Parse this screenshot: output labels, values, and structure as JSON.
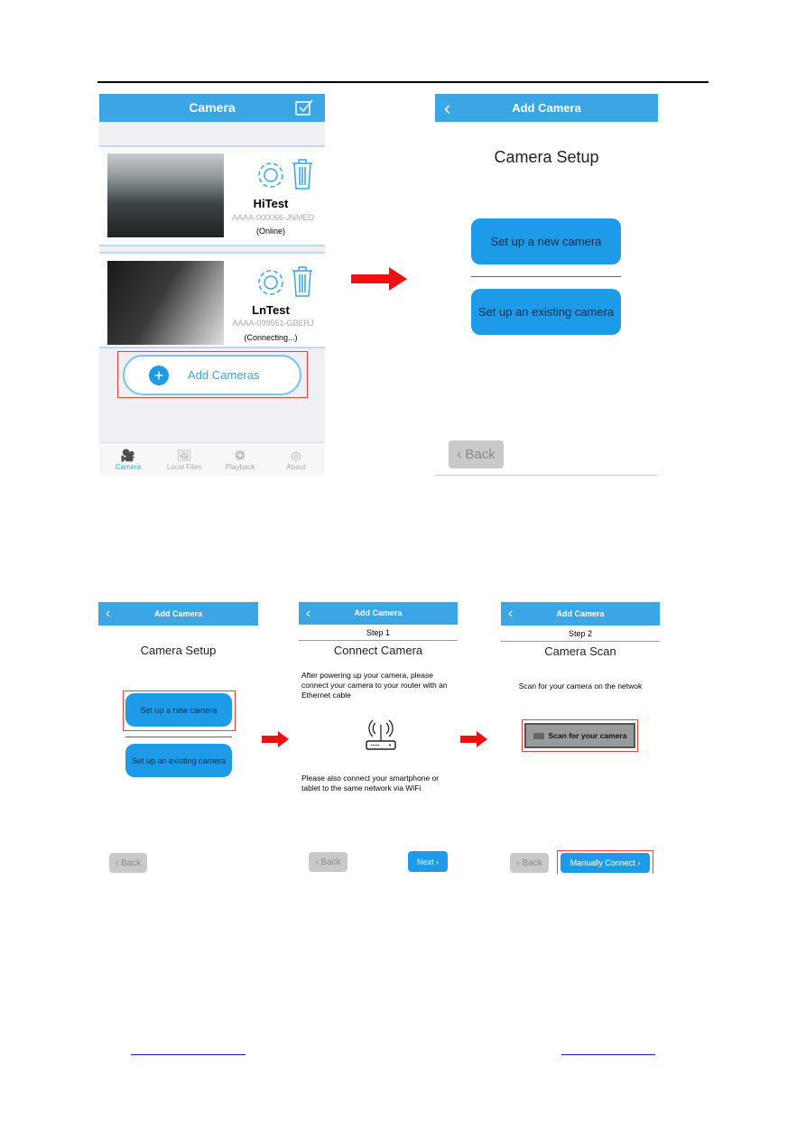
{
  "colors": {
    "accent": "#3aa6e6",
    "button": "#1e9be8",
    "highlight": "#e8413f",
    "arrow": "#f01010"
  },
  "camera_list": {
    "title": "Camera",
    "edit_icon": "checkbox-icon",
    "cameras": [
      {
        "name": "HiTest",
        "uid": "AAAA-000066-JNMED",
        "status": "(Online)"
      },
      {
        "name": "LnTest",
        "uid": "AAAA-099551-GBERJ",
        "status": "(Connecting...)"
      }
    ],
    "add_label": "Add Cameras",
    "tabs": [
      {
        "label": "Camera",
        "icon": "video-camera-icon",
        "active": true
      },
      {
        "label": "Local Files",
        "icon": "image-icon"
      },
      {
        "label": "Playback",
        "icon": "film-reel-icon"
      },
      {
        "label": "About",
        "icon": "user-icon"
      }
    ]
  },
  "setup": {
    "title": "Add Camera",
    "heading": "Camera Setup",
    "new_label": "Set up a new camera",
    "existing_label": "Set up an existing camera",
    "back_label": "Back"
  },
  "step1": {
    "title": "Add Camera",
    "step": "Step 1",
    "heading": "Connect Camera",
    "text1": "After powering up your camera, please connect your camera to your router with an Ethernet cable",
    "text2": "Please also connect your smartphone or tablet to the same network via WiFi",
    "back_label": "Back",
    "next_label": "Next"
  },
  "step2": {
    "title": "Add Camera",
    "step": "Step 2",
    "heading": "Camera Scan",
    "text": "Scan for your camera on the netwok",
    "scan_label": "Scan for your camera",
    "back_label": "Back",
    "manual_label": "Manually Connect"
  }
}
